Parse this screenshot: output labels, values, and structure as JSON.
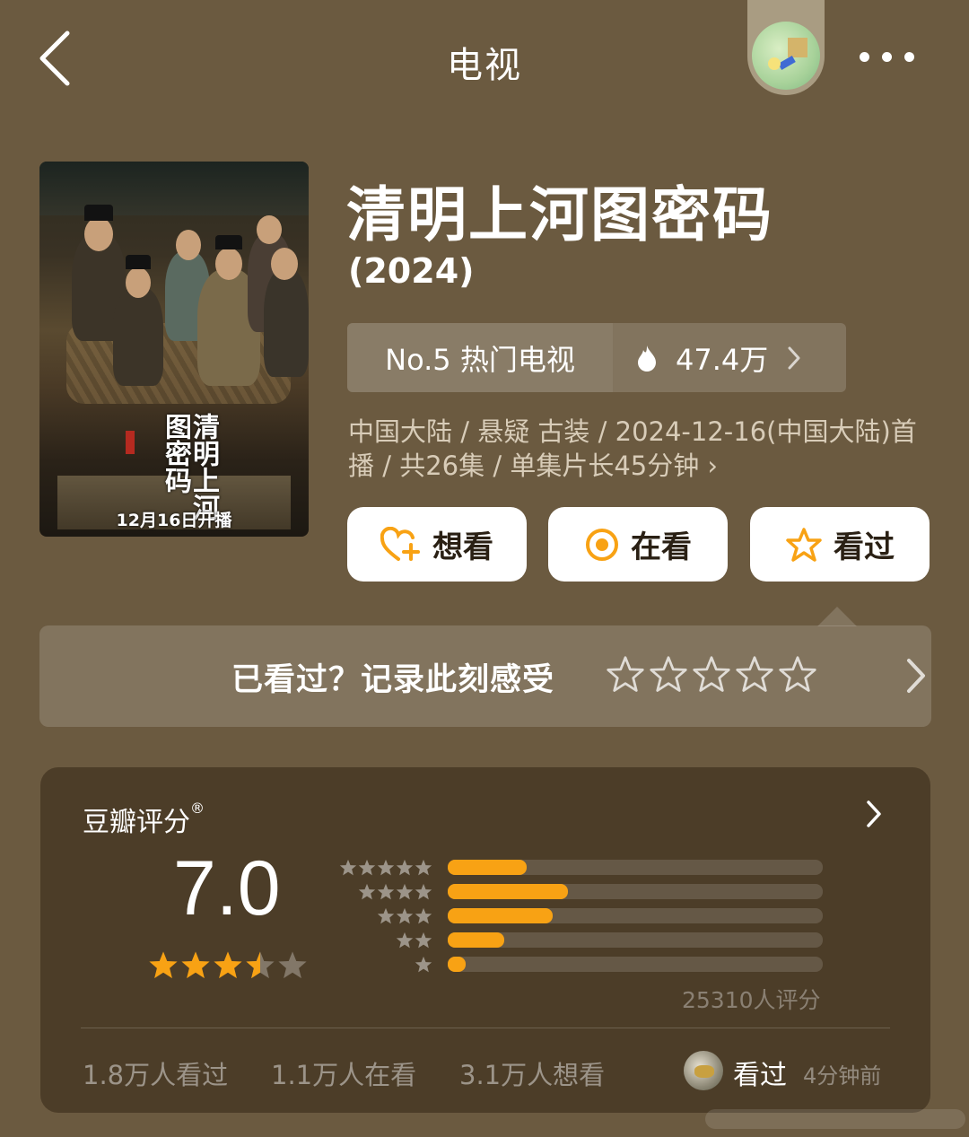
{
  "header": {
    "title": "电视",
    "back_icon": "chevron-left-icon",
    "more_icon": "more-dots-icon"
  },
  "poster": {
    "title_text": "清明上河图密码",
    "date_text": "12月16日开播"
  },
  "show": {
    "title": "清明上河图密码",
    "year": "(2024)"
  },
  "rank": {
    "label": "No.5 热门电视",
    "heat": "47.4万"
  },
  "meta": {
    "text": "中国大陆 / 悬疑 古装 / 2024-12-16(中国大陆)首播 / 共26集 / 单集片长45分钟 ›"
  },
  "actions": {
    "want": "想看",
    "watching": "在看",
    "watched": "看过"
  },
  "record": {
    "text": "已看过？记录此刻感受"
  },
  "rating": {
    "label": "豆瓣评分",
    "label_mark": "®",
    "score": "7.0",
    "stars_value": 3.5,
    "count": "25310人评分",
    "distribution": [
      {
        "stars": 5,
        "fraction": 0.21
      },
      {
        "stars": 4,
        "fraction": 0.32
      },
      {
        "stars": 3,
        "fraction": 0.28
      },
      {
        "stars": 2,
        "fraction": 0.15
      },
      {
        "stars": 1,
        "fraction": 0.04
      }
    ],
    "stats": {
      "watched": "1.8万人看过",
      "watching": "1.1万人在看",
      "want": "3.1万人想看"
    },
    "friend": {
      "action": "看过",
      "time": "4分钟前"
    }
  },
  "colors": {
    "background": "#6b5a40",
    "card": "#4c3d28",
    "accent": "#f8a214"
  }
}
